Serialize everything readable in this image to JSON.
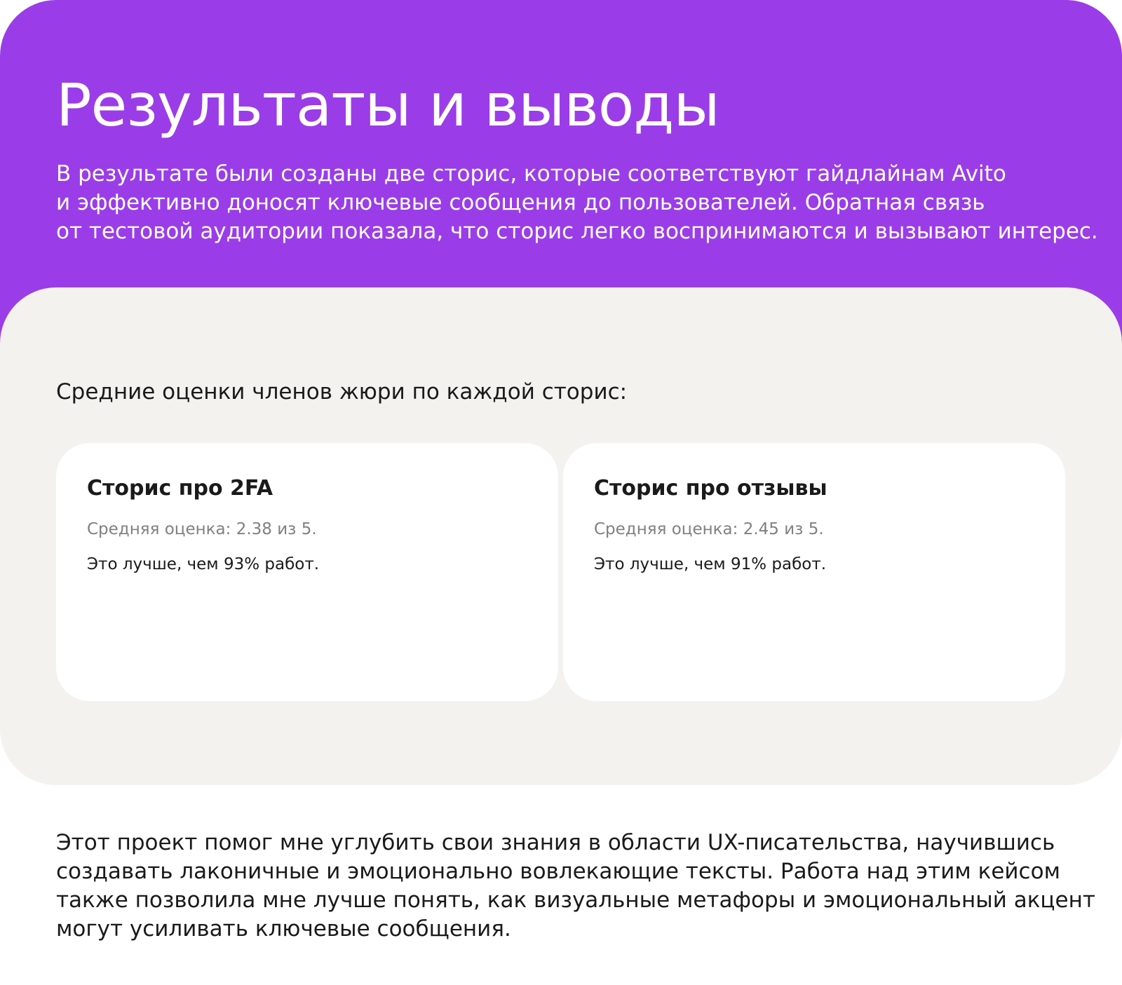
{
  "hero": {
    "title": "Результаты и выводы",
    "paragraph_lines": [
      "В результате были созданы две сторис, которые соответствуют гайдлайнам Avito",
      "и эффективно доносят ключевые сообщения до пользователей. Обратная связь",
      "от тестовой аудитории показала, что сторис легко воспринимаются и вызывают интерес."
    ],
    "background_color": "#9a3de8"
  },
  "scores": {
    "heading": "Средние оценки членов жюри по каждой сторис:",
    "cards": [
      {
        "title": "Сторис про 2FA",
        "score_text": "Средняя оценка: 2.38 из 5.",
        "compare_text": "Это лучше, чем 93% работ."
      },
      {
        "title": "Сторис про отзывы",
        "score_text": "Средняя оценка: 2.45 из 5.",
        "compare_text": "Это лучше, чем 91% работ."
      }
    ],
    "background_color": "#f3f2ef"
  },
  "conclusion": {
    "lines": [
      "Этот проект помог мне углубить свои знания в области UX-писательства, научившись",
      "создавать лаконичные и эмоционально вовлекающие тексты. Работа над этим кейсом",
      "также позволила мне лучше понять, как визуальные метафоры и эмоциональный акцент",
      "могут усиливать ключевые сообщения."
    ]
  }
}
